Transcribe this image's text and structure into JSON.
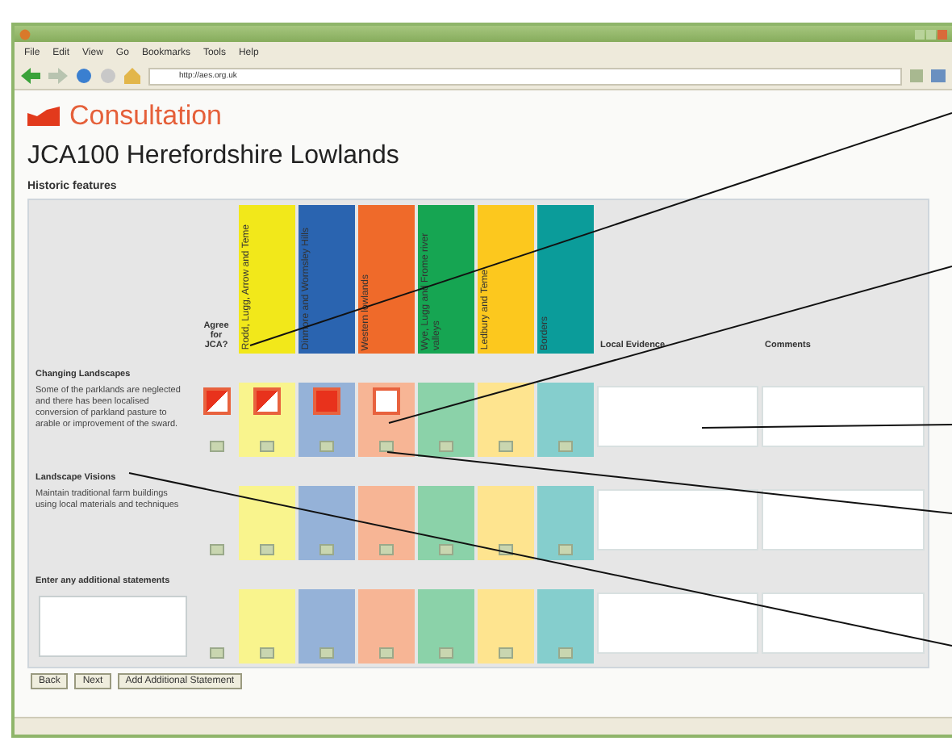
{
  "browser": {
    "menu": [
      "File",
      "Edit",
      "View",
      "Go",
      "Bookmarks",
      "Tools",
      "Help"
    ],
    "address": "http://aes.org.uk"
  },
  "page": {
    "logo": "Consultation",
    "heading": "JCA100 Herefordshire Lowlands",
    "subheading": "Historic features"
  },
  "table": {
    "agree_column": "Agree for JCA?",
    "areas": [
      {
        "label": "Rodd, Lugg, Arrow and Teme",
        "color": "#f2e81a"
      },
      {
        "label": "Dinmore and Wormsley Hills",
        "color": "#2a64b0"
      },
      {
        "label": "Western lowlands",
        "color": "#ef6a2a"
      },
      {
        "label": "Wye, Lugg and Frome river valleys",
        "color": "#16a552"
      },
      {
        "label": "Ledbury and Teme",
        "color": "#fcc81e"
      },
      {
        "label": "Borders",
        "color": "#0b9c9a"
      }
    ],
    "evidence_column": "Local Evidence",
    "comments_column": "Comments",
    "rows": [
      {
        "kind": "statement",
        "section": "Changing Landscapes",
        "text": "Some of the parklands are neglected and there has been localised conversion of parkland pasture to arable or improvement of the sward.",
        "cells": [
          {
            "kind": "half"
          },
          {
            "kind": "half"
          },
          {
            "kind": "full"
          },
          {
            "kind": "empty"
          },
          {
            "kind": "blank"
          },
          {
            "kind": "blank"
          },
          {
            "kind": "blank"
          }
        ]
      },
      {
        "kind": "statement",
        "section": "Landscape Visions",
        "text": "Maintain traditional farm buildings using local materials and techniques",
        "cells": [
          {
            "kind": "blank"
          },
          {
            "kind": "blank"
          },
          {
            "kind": "blank"
          },
          {
            "kind": "blank"
          },
          {
            "kind": "blank"
          },
          {
            "kind": "blank"
          },
          {
            "kind": "blank"
          }
        ]
      },
      {
        "kind": "entry",
        "section": "Enter any additional statements",
        "cells": [
          {
            "kind": "blank"
          },
          {
            "kind": "blank"
          },
          {
            "kind": "blank"
          },
          {
            "kind": "blank"
          },
          {
            "kind": "blank"
          },
          {
            "kind": "blank"
          },
          {
            "kind": "blank"
          }
        ]
      }
    ]
  },
  "buttons": [
    "Back",
    "Next",
    "Add Additional Statement"
  ]
}
